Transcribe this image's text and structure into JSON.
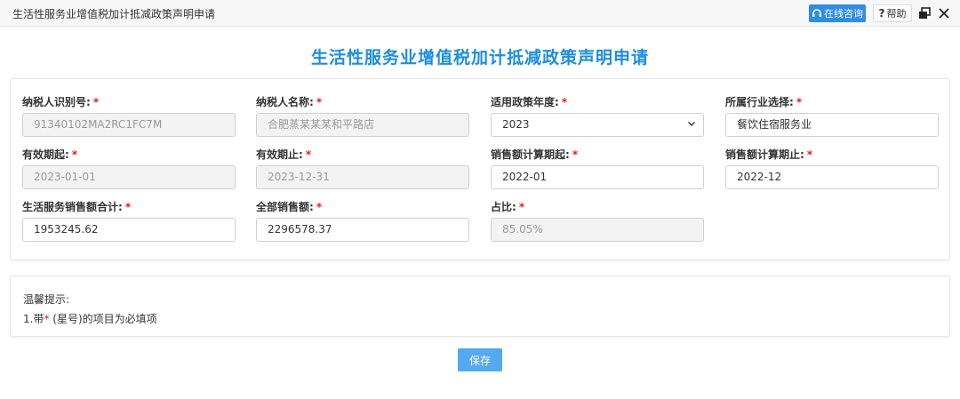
{
  "window": {
    "title": "生活性服务业增值税加计抵减政策声明申请",
    "consult_label": "在线咨询",
    "help_label": "帮助",
    "help_mark": "?"
  },
  "page": {
    "title": "生活性服务业增值税加计抵减政策声明申请"
  },
  "required_mark": "*",
  "form": {
    "taxpayer_id": {
      "label": "纳税人识别号:",
      "value": "91340102MA2RC1FC7M"
    },
    "taxpayer_name": {
      "label": "纳税人名称:",
      "value": "合肥蒸某某某和平路店"
    },
    "policy_year": {
      "label": "适用政策年度:",
      "value": "2023"
    },
    "industry": {
      "label": "所属行业选择:",
      "value": "餐饮住宿服务业"
    },
    "valid_from": {
      "label": "有效期起:",
      "value": "2023-01-01"
    },
    "valid_to": {
      "label": "有效期止:",
      "value": "2023-12-31"
    },
    "sales_period_start": {
      "label": "销售额计算期起:",
      "value": "2022-01"
    },
    "sales_period_end": {
      "label": "销售额计算期止:",
      "value": "2022-12"
    },
    "life_service_sales_total": {
      "label": "生活服务销售额合计:",
      "value": "1953245.62"
    },
    "total_sales": {
      "label": "全部销售额:",
      "value": "2296578.37"
    },
    "ratio": {
      "label": "占比:",
      "value": "85.05%"
    }
  },
  "tips": {
    "title": "温馨提示:",
    "line1_prefix": "1.带",
    "line1_star": "*",
    "line1_suffix": "(星号)的项目为必填项"
  },
  "actions": {
    "save_label": "保存"
  },
  "colors": {
    "accent": "#1c8ee0",
    "required": "#e02020",
    "button": "#55a9f0"
  }
}
